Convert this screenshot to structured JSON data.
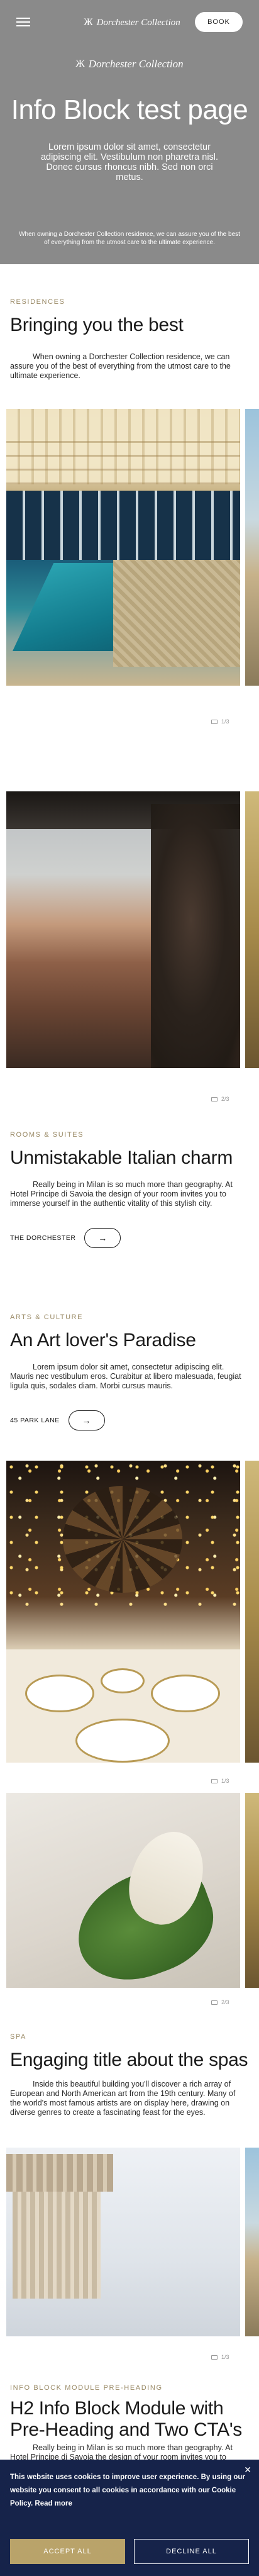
{
  "header": {
    "brand": "Dorchester Collection",
    "book_label": "BOOK"
  },
  "hero": {
    "brand": "Dorchester Collection",
    "title": "Info Block test page",
    "subtitle": "Lorem ipsum dolor sit amet, consectetur adipiscing elit. Vestibulum non pharetra nisl. Donec cursus rhoncus nibh. Sed non orci metus.",
    "footnote": "When owning a Dorchester Collection residence, we can assure you of the best of everything from the utmost care to the ultimate experience."
  },
  "residences": {
    "eyebrow": "RESIDENCES",
    "title": "Bringing you the best",
    "body": "When owning a Dorchester Collection residence, we can assure you of the best of everything from the utmost care to the ultimate experience.",
    "pager1": "1/3",
    "pager2": "2/3"
  },
  "rooms": {
    "eyebrow": "ROOMS & SUITES",
    "title": "Unmistakable Italian charm",
    "body": "Really being in Milan is so much more than geography. At Hotel Principe di Savoia the design of your room invites you to immerse yourself in the authentic vitality of this stylish city.",
    "link": "THE DORCHESTER",
    "arrow": "→"
  },
  "arts": {
    "eyebrow": "ARTS & CULTURE",
    "title": "An Art lover's Paradise",
    "body": "Lorem ipsum dolor sit amet, consectetur adipiscing elit. Mauris nec vestibulum eros. Curabitur at libero malesuada, feugiat ligula quis, sodales diam. Morbi cursus mauris.",
    "link": "45 PARK LANE",
    "arrow": "→",
    "pager1": "1/3",
    "pager2": "2/3"
  },
  "spa": {
    "eyebrow": "SPA",
    "title": "Engaging title about the spas",
    "body": "Inside this beautiful building you'll discover a rich array of European and North American art from the 19th century. Many of the world's most famous artists are on display here, drawing on diverse genres to create a fascinating feast for the eyes.",
    "pager1": "1/3"
  },
  "module": {
    "eyebrow": "INFO BLOCK MODULE PRE-HEADING",
    "title": "H2 Info Block Module with Pre-Heading and Two CTA's",
    "body": "Really being in Milan is so much more than geography. At Hotel Principe di Savoia the design of your room invites you to immerse yourself in the authentic vitality of this stylish city. Really being in Milan is so much more than geography. At Hotel Principe"
  },
  "cookie": {
    "text": "This website uses cookies to improve user experience. By using our website you consent to all cookies in accordance with our Cookie Policy.",
    "read_more": "Read more",
    "accept": "ACCEPT ALL",
    "decline": "DECLINE ALL",
    "close": "✕"
  }
}
